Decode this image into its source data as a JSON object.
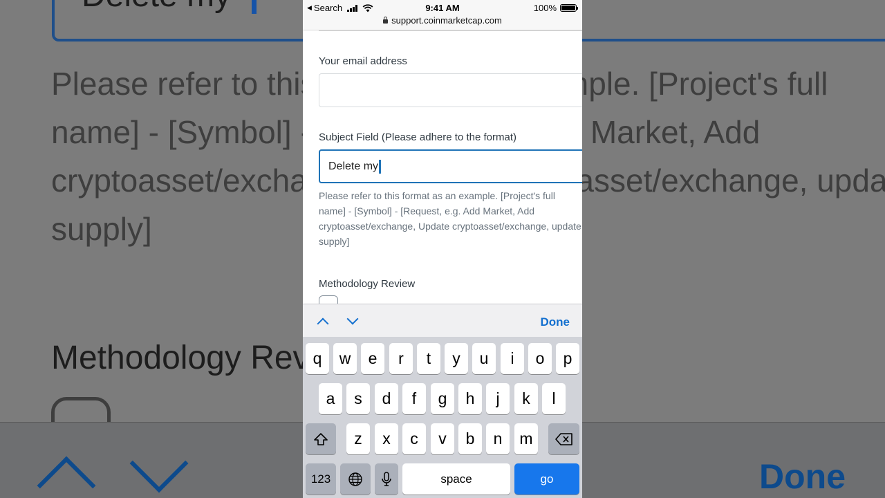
{
  "background": {
    "field_text": "Delete my",
    "help_text": "Please refer to this format as an example. [Project's full name] - [Symbol] - [Request, e.g. Add Market, Add cryptoasset/exchange, Update cryptoasset/exchange, update supply]",
    "section_label": "Methodology Review",
    "done_label": "Done"
  },
  "status_bar": {
    "back_label": "Search",
    "time": "9:41 AM",
    "battery": "100%"
  },
  "url_bar": {
    "domain": "support.coinmarketcap.com"
  },
  "form": {
    "email_label": "Your email address",
    "email_value": "",
    "subject_label": "Subject Field (Please adhere to the format)",
    "subject_value": "Delete my",
    "subject_help": "Please refer to this format as an example. [Project's full name] - [Symbol] - [Request, e.g. Add Market, Add cryptoasset/exchange, Update cryptoasset/exchange, update supply]",
    "methodology_label": "Methodology Review"
  },
  "accessory_bar": {
    "done_label": "Done"
  },
  "keyboard": {
    "row1": [
      "q",
      "w",
      "e",
      "r",
      "t",
      "y",
      "u",
      "i",
      "o",
      "p"
    ],
    "row2": [
      "a",
      "s",
      "d",
      "f",
      "g",
      "h",
      "j",
      "k",
      "l"
    ],
    "row3": [
      "z",
      "x",
      "c",
      "v",
      "b",
      "n",
      "m"
    ],
    "numbers_label": "123",
    "space_label": "space",
    "go_label": "go"
  },
  "colors": {
    "accent": "#1f73b7",
    "go_key": "#1777ec",
    "link_blue": "#1470cf"
  }
}
